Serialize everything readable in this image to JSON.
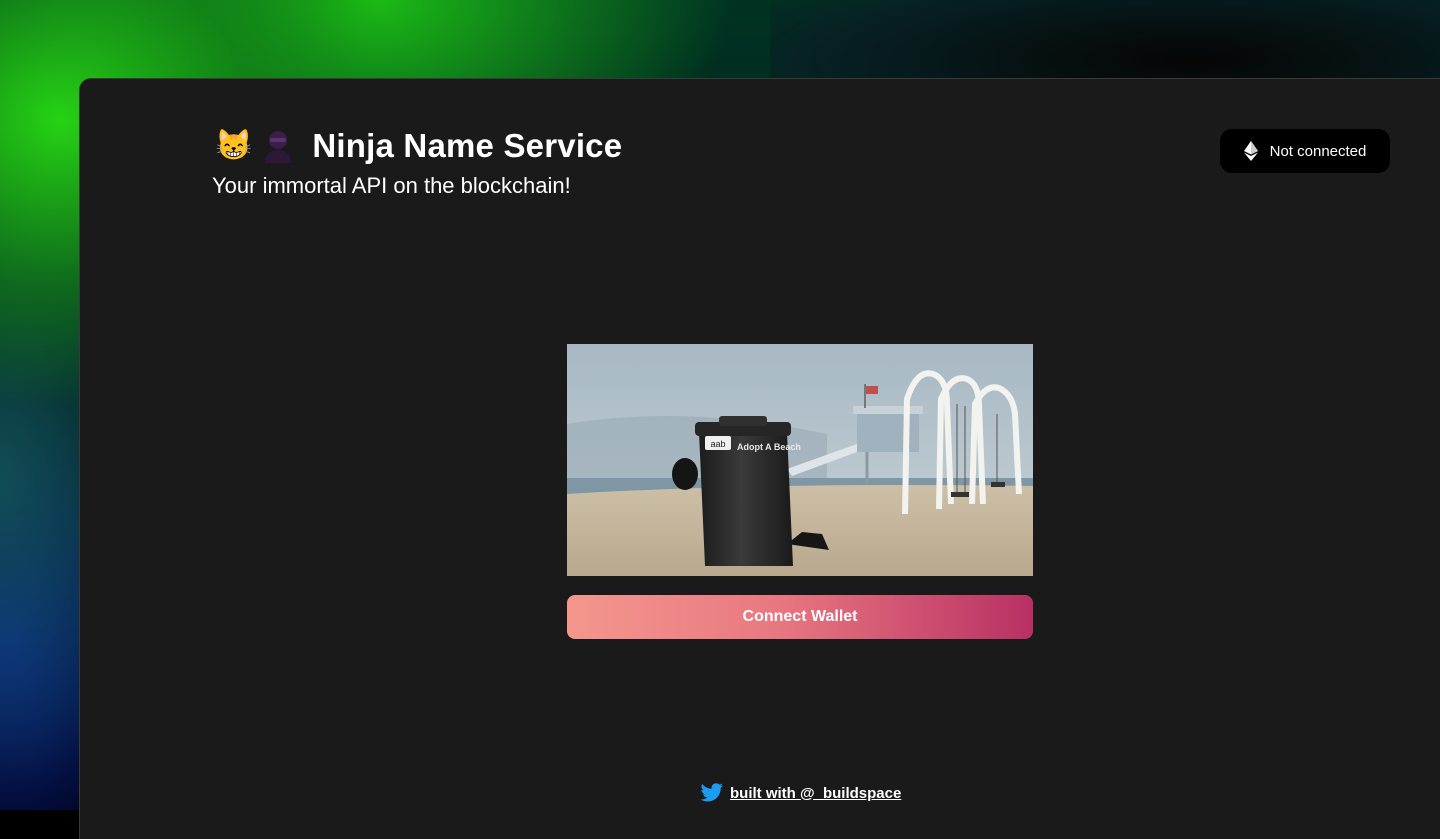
{
  "app": {
    "title": "Ninja Name Service",
    "subtitle": "Your immortal API on the blockchain!",
    "emoji_cat": "😸"
  },
  "wallet": {
    "status_label": "Not connected",
    "connect_label": "Connect Wallet"
  },
  "media": {
    "bin_label": "Adopt A Beach",
    "bin_logo": "aab"
  },
  "footer": {
    "link_label": "built with @_buildspace"
  },
  "colors": {
    "background": "#1a1a1a",
    "button_gradient_start": "#f4978e",
    "button_gradient_end": "#b83064",
    "twitter_blue": "#1d9bf0"
  },
  "icons": [
    "cat-emoji-icon",
    "ninja-icon",
    "ethereum-icon",
    "twitter-icon"
  ]
}
